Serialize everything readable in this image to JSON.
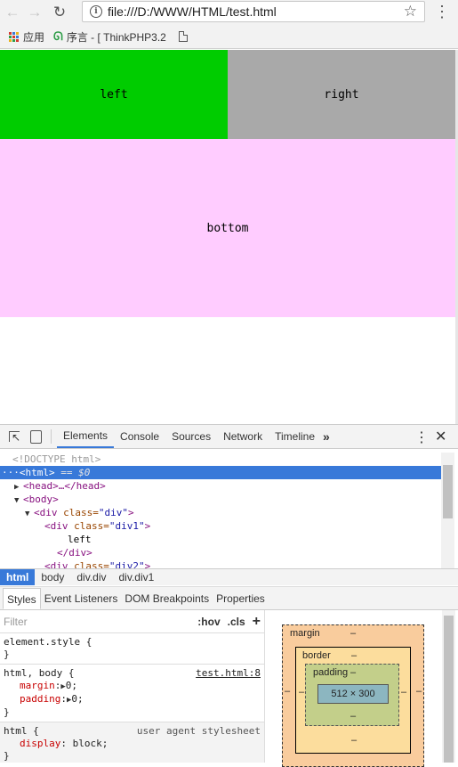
{
  "browser": {
    "url": "file:///D:/WWW/HTML/test.html",
    "nav_back": "←",
    "nav_forward": "→",
    "reload": "↻",
    "star": "☆",
    "menu": "⋮",
    "info": "i"
  },
  "bookmarks": [
    {
      "label": "应用",
      "icon": "apps-grid-icon"
    },
    {
      "label": "序言 - [ ThinkPHP3.2",
      "icon": "swirl-icon"
    },
    {
      "label": "",
      "icon": "document-icon"
    }
  ],
  "page": {
    "left": "left",
    "right": "right",
    "bottom": "bottom",
    "colors": {
      "left": "#00cc00",
      "right": "#a9a9a9",
      "bottom": "#ffccff"
    }
  },
  "devtools": {
    "tabs": [
      "Elements",
      "Console",
      "Sources",
      "Network",
      "Timeline"
    ],
    "more": "»",
    "kebab": "⋮",
    "close": "✕",
    "dom": {
      "doctype": "<!DOCTYPE html>",
      "html_open": "<html>",
      "html_selected_suffix": " == $0",
      "head": "<head>…</head>",
      "body_open": "<body>",
      "div_open": "<div",
      "div_class_attr": " class=",
      "div_class_val": "\"div\"",
      "div1_open": "<div",
      "div1_class_val": "\"div1\"",
      "left_text": "left",
      "div_close": "</div>",
      "div2_open": "<div",
      "div2_class_val": "\"div2\"",
      "gt": ">"
    },
    "breadcrumbs": [
      "html",
      "body",
      "div.div",
      "div.div1"
    ],
    "sub_tabs": [
      "Styles",
      "Event Listeners",
      "DOM Breakpoints",
      "Properties"
    ],
    "styles": {
      "filter_placeholder": "Filter",
      "hov": ":hov",
      "cls": ".cls",
      "plus": "+",
      "element_style": "element.style {",
      "close_brace": "}",
      "rule2_selector": "html, body {",
      "rule2_source": "test.html:8",
      "margin_name": "margin",
      "margin_value": "0;",
      "padding_name": "padding",
      "padding_value": "0;",
      "rule3_selector": "html {",
      "rule3_source": "user agent stylesheet",
      "display_name": "display",
      "display_value": "block;"
    },
    "box_model": {
      "margin_label": "margin",
      "border_label": "border",
      "padding_label": "padding",
      "dash": "–",
      "content_size": "512 × 300"
    }
  }
}
